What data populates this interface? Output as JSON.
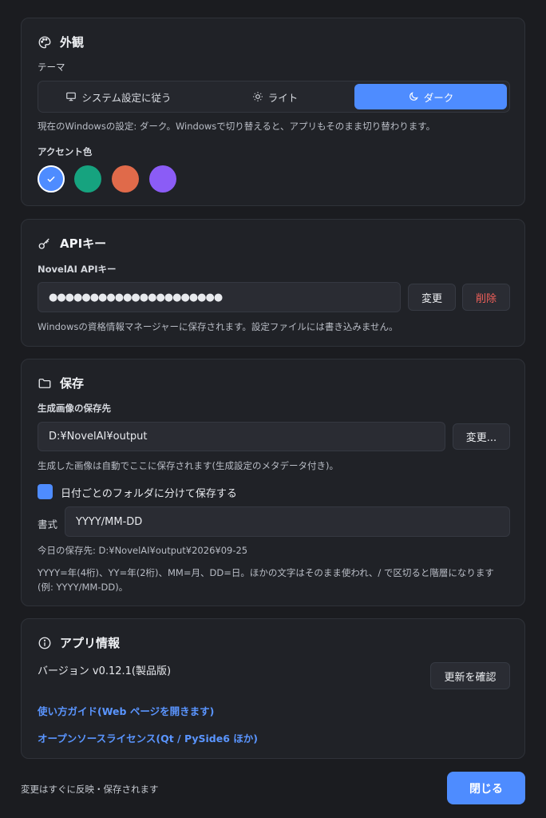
{
  "appearance": {
    "title": "外観",
    "theme_label": "テーマ",
    "theme_options": [
      "システム設定に従う",
      "ライト",
      "ダーク"
    ],
    "selected_theme": "ダーク",
    "theme_hint": "現在のWindowsの設定: ダーク。Windowsで切り替えると、アプリもそのまま切り替わります。",
    "accent_label": "アクセント色",
    "accent_colors": [
      "#4e8cff",
      "#16a37f",
      "#e06a4a",
      "#8b5cf6"
    ],
    "selected_accent": "#4e8cff"
  },
  "api": {
    "title": "APIキー",
    "field_label": "NovelAI APIキー",
    "masked_key": "●●●●●●●●●●●●●●●●●●●●●",
    "change_label": "変更",
    "delete_label": "削除",
    "hint": "Windowsの資格情報マネージャーに保存されます。設定ファイルには書き込みません。"
  },
  "save": {
    "title": "保存",
    "path_label": "生成画像の保存先",
    "path_value": "D:¥NovelAI¥output",
    "change_label": "変更...",
    "path_hint": "生成した画像は自動でここに保存されます(生成設定のメタデータ付き)。",
    "split_by_date_label": "日付ごとのフォルダに分けて保存する",
    "split_by_date_checked": true,
    "format_label": "書式",
    "format_value": "YYYY/MM-DD",
    "today_path": "今日の保存先: D:¥NovelAI¥output¥2026¥09-25",
    "format_hint": "YYYY=年(4桁)、YY=年(2桁)、MM=月、DD=日。ほかの文字はそのまま使われ、/ で区切ると階層になります(例: YYYY/MM-DD)。"
  },
  "about": {
    "title": "アプリ情報",
    "version": "バージョン v0.12.1(製品版)",
    "check_update_label": "更新を確認",
    "guide_link": "使い方ガイド(Web ページを開きます)",
    "license_link": "オープンソースライセンス(Qt / PySide6 ほか)"
  },
  "footer": {
    "note": "変更はすぐに反映・保存されます",
    "close_label": "閉じる"
  }
}
